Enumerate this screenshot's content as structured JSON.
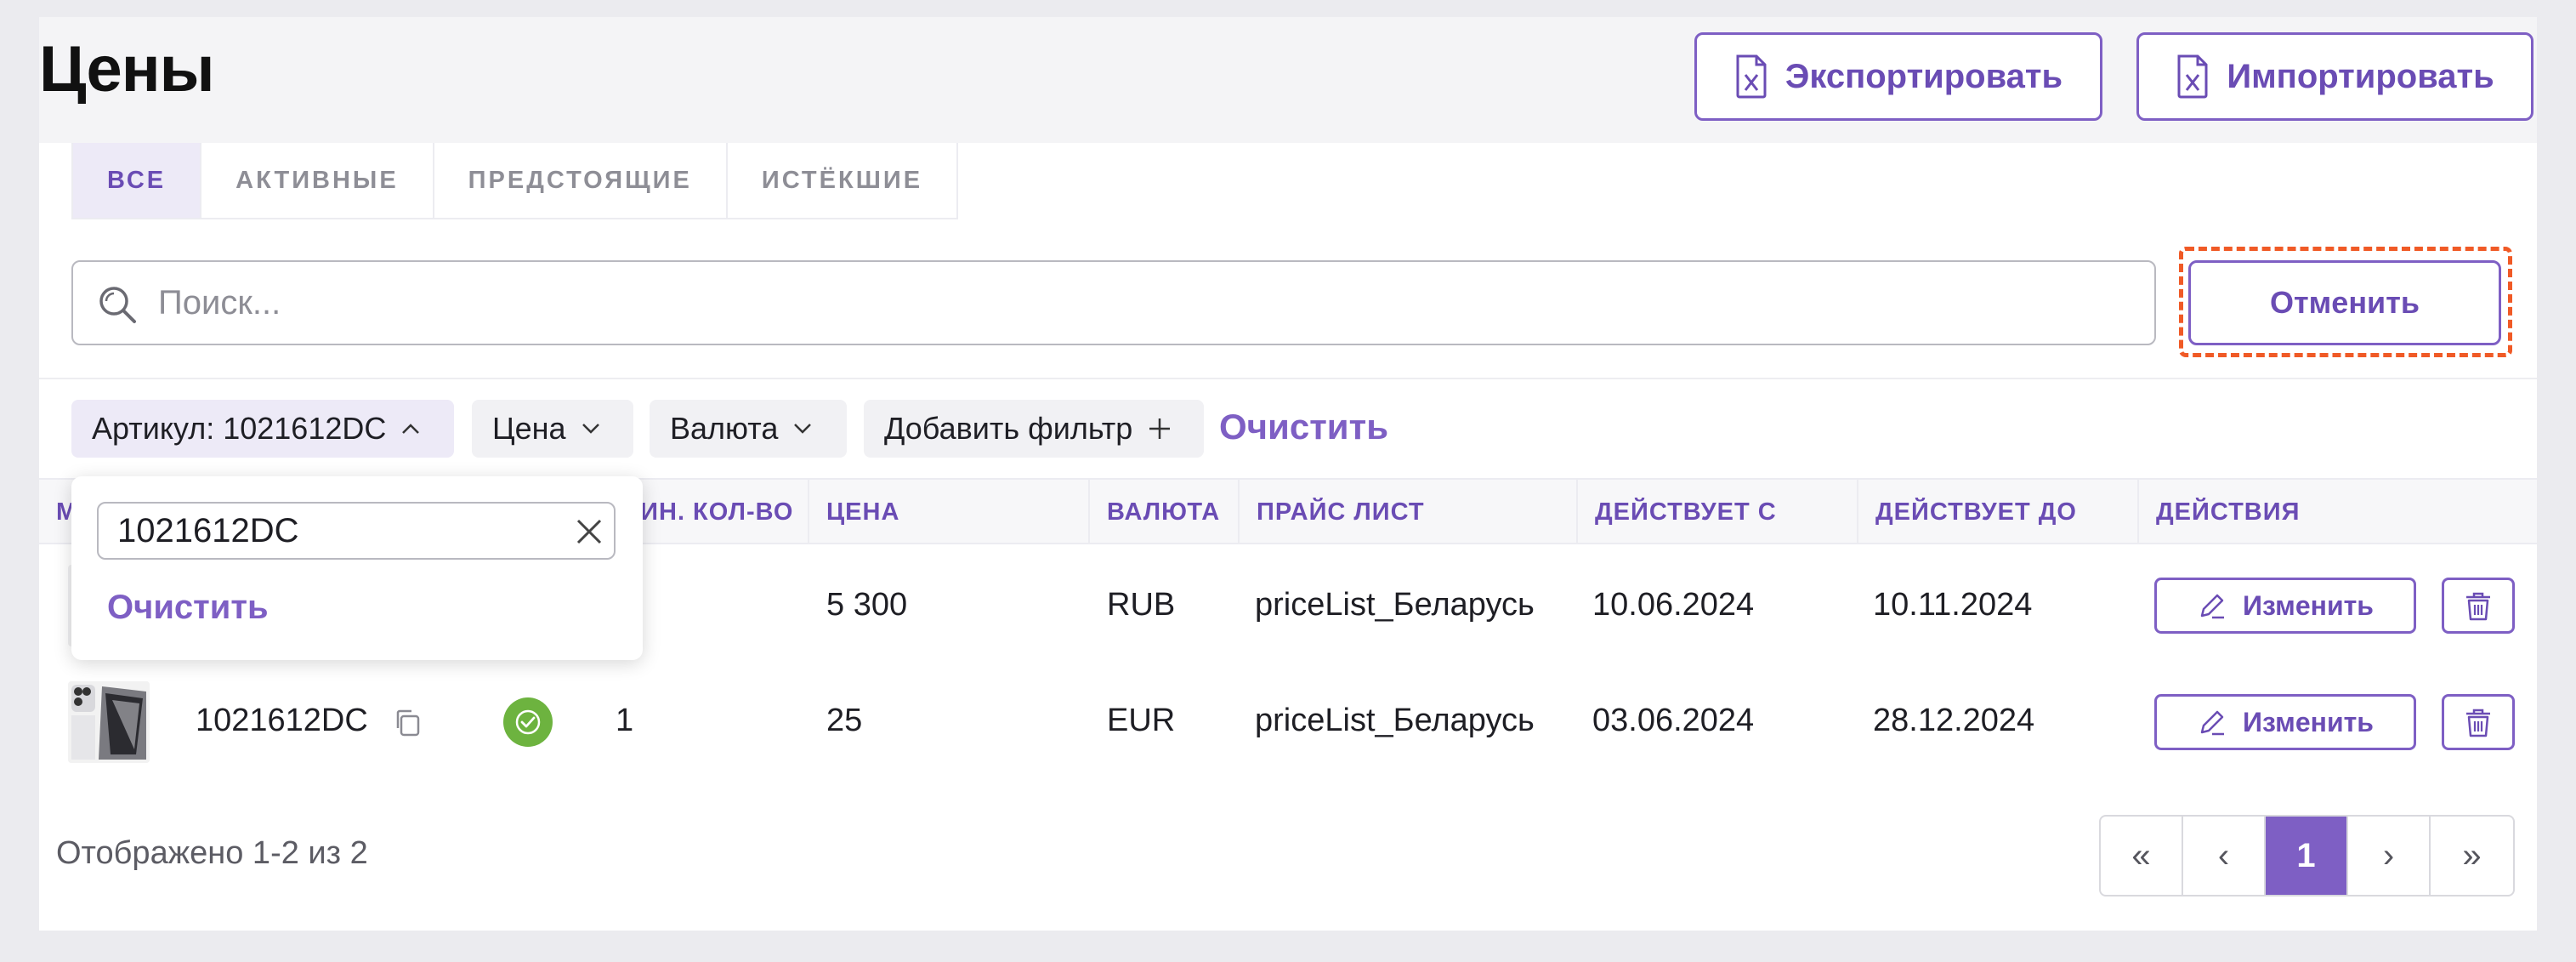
{
  "header": {
    "title": "Цены",
    "export_label": "Экспортировать",
    "import_label": "Импортировать"
  },
  "tabs": [
    {
      "label": "ВСЕ",
      "active": true
    },
    {
      "label": "АКТИВНЫЕ",
      "active": false
    },
    {
      "label": "ПРЕДСТОЯЩИЕ",
      "active": false
    },
    {
      "label": "ИСТЁКШИЕ",
      "active": false
    }
  ],
  "search": {
    "placeholder": "Поиск...",
    "cancel_label": "Отменить"
  },
  "filters": {
    "chips": [
      {
        "label": "Артикул: 1021612DC",
        "active": true,
        "chevron": "chevron-up-icon"
      },
      {
        "label": "Цена",
        "active": false,
        "chevron": "chevron-down-icon"
      },
      {
        "label": "Валюта",
        "active": false,
        "chevron": "chevron-down-icon"
      },
      {
        "label": "Добавить фильтр",
        "active": false,
        "chevron": "plus-icon"
      }
    ],
    "clear_label": "Очистить"
  },
  "popover": {
    "input_value": "1021612DC",
    "clear_label": "Очистить"
  },
  "table": {
    "columns": [
      "М",
      "",
      "",
      "МИН. КОЛ-ВО",
      "ЦЕНА",
      "ВАЛЮТА",
      "ПРАЙС ЛИСТ",
      "ДЕЙСТВУЕТ С",
      "ДЕЙСТВУЕТ ДО",
      "ДЕЙСТВИЯ"
    ],
    "rows": [
      {
        "sku": "",
        "qty": "",
        "price": "5 300",
        "currency": "RUB",
        "price_list": "priceList_Беларусь",
        "from": "10.06.2024",
        "to": "10.11.2024",
        "edit_label": "Изменить"
      },
      {
        "sku": "1021612DC",
        "qty": "1",
        "price": "25",
        "currency": "EUR",
        "price_list": "priceList_Беларусь",
        "from": "03.06.2024",
        "to": "28.12.2024",
        "edit_label": "Изменить"
      }
    ]
  },
  "footer": {
    "shown_text": "Отображено 1-2 из 2",
    "pages": [
      "«",
      "‹",
      "1",
      "›",
      "»"
    ],
    "current_page": "1"
  },
  "colors": {
    "accent": "#7e5fc4",
    "focus_outline": "#f05a26",
    "status_active": "#6db33f"
  }
}
